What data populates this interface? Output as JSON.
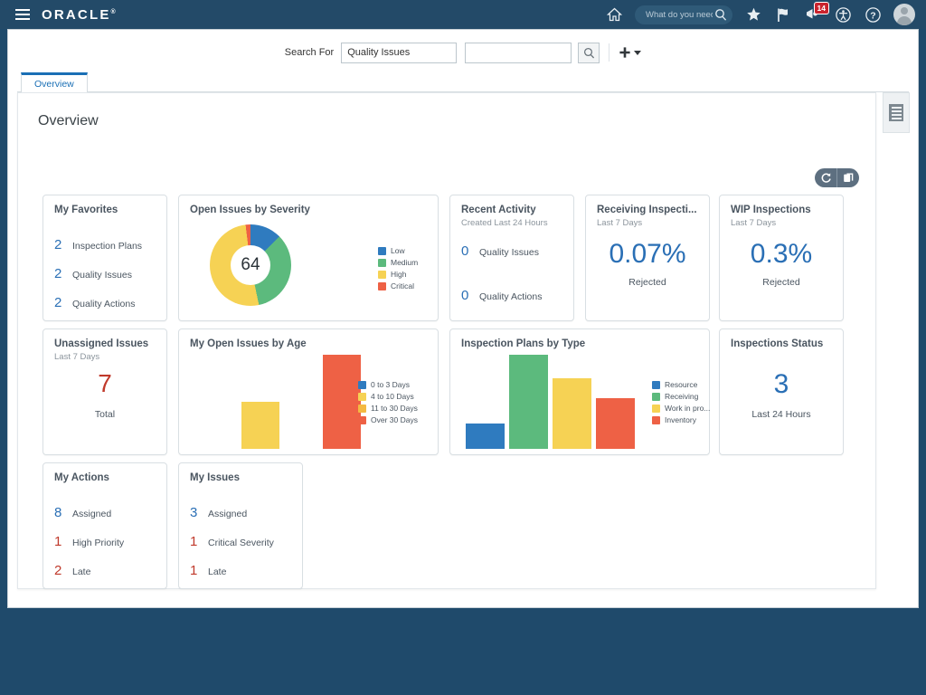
{
  "global_header": {
    "logo": "ORACLE",
    "logo_mark": "®",
    "menu_icon": "hamburger-menu-icon",
    "home_icon": "home-icon",
    "search_placeholder": "What do you need",
    "search_value": "",
    "search_icon": "search-icon",
    "favorites_icon": "star-icon",
    "flag_icon": "flag-icon",
    "notifications_icon": "bell-icon",
    "notifications_count": "14",
    "accessibility_icon": "accessibility-icon",
    "help_icon": "help-icon",
    "avatar_icon": "user-avatar"
  },
  "search_toolbar": {
    "label": "Search For",
    "category_value": "Quality Issues",
    "query_value": "",
    "query_placeholder": "",
    "go_icon": "search-icon",
    "add_icon": "plus-icon"
  },
  "tabs": [
    {
      "label": "Overview",
      "selected": true
    }
  ],
  "page": {
    "title": "Overview",
    "refresh_icon": "refresh-icon",
    "layout_icon": "pages-icon",
    "side_panel_icon": "list-panel-icon"
  },
  "tiles": {
    "my_favorites": {
      "title": "My Favorites",
      "rows": [
        {
          "value": "2",
          "label": "Inspection Plans",
          "color": "blue"
        },
        {
          "value": "2",
          "label": "Quality Issues",
          "color": "blue"
        },
        {
          "value": "2",
          "label": "Quality Actions",
          "color": "blue"
        }
      ]
    },
    "recent_activity": {
      "title": "Recent Activity",
      "subtitle": "Created Last 24 Hours",
      "rows": [
        {
          "value": "0",
          "label": "Quality Issues",
          "color": "blue"
        },
        {
          "value": "0",
          "label": "Quality Actions",
          "color": "blue"
        }
      ]
    },
    "receiving_inspections": {
      "title": "Receiving Inspecti...",
      "subtitle": "Last 7 Days",
      "value": "0.07%",
      "caption": "Rejected"
    },
    "wip_inspections": {
      "title": "WIP Inspections",
      "subtitle": "Last 7 Days",
      "value": "0.3%",
      "caption": "Rejected"
    },
    "unassigned_issues": {
      "title": "Unassigned Issues",
      "subtitle": "Last 7 Days",
      "value": "7",
      "caption": "Total"
    },
    "inspections_status": {
      "title": "Inspections Status",
      "value": "3",
      "caption": "Last 24 Hours"
    },
    "my_actions": {
      "title": "My Actions",
      "rows": [
        {
          "value": "8",
          "label": "Assigned",
          "color": "blue"
        },
        {
          "value": "1",
          "label": "High Priority",
          "color": "red"
        },
        {
          "value": "2",
          "label": "Late",
          "color": "red"
        }
      ]
    },
    "my_issues": {
      "title": "My Issues",
      "rows": [
        {
          "value": "3",
          "label": "Assigned",
          "color": "blue"
        },
        {
          "value": "1",
          "label": "Critical Severity",
          "color": "red"
        },
        {
          "value": "1",
          "label": "Late",
          "color": "red"
        }
      ]
    }
  },
  "chart_data": [
    {
      "id": "open_issues_by_severity",
      "type": "pie",
      "title": "Open Issues by Severity",
      "center_label": "64",
      "total": 64,
      "legend_position": "right",
      "categories": [
        "Low",
        "Medium",
        "High",
        "Critical"
      ],
      "values": [
        8,
        22,
        33,
        1
      ],
      "colors": [
        "#2f7bbf",
        "#5cba7d",
        "#f6d254",
        "#ee6145"
      ]
    },
    {
      "id": "my_open_issues_by_age",
      "type": "bar",
      "title": "My Open Issues by Age",
      "legend_position": "right",
      "categories": [
        "0 to 3 Days",
        "4 to 10 Days",
        "11 to 30 Days",
        "Over 30 Days"
      ],
      "values": [
        0,
        1,
        0,
        2
      ],
      "colors": [
        "#2f7bbf",
        "#f6d254",
        "#f4b942",
        "#ee6145"
      ],
      "xlabel": "",
      "ylabel": "",
      "ylim": [
        0,
        2
      ]
    },
    {
      "id": "inspection_plans_by_type",
      "type": "bar",
      "title": "Inspection Plans by Type",
      "legend_position": "right",
      "categories": [
        "Resource",
        "Receiving",
        "Work in pro...",
        "Inventory"
      ],
      "values": [
        1,
        4,
        3,
        2
      ],
      "colors": [
        "#2f7bbf",
        "#5cba7d",
        "#f6d254",
        "#ee6145"
      ],
      "xlabel": "",
      "ylabel": "",
      "ylim": [
        0,
        4
      ]
    }
  ]
}
